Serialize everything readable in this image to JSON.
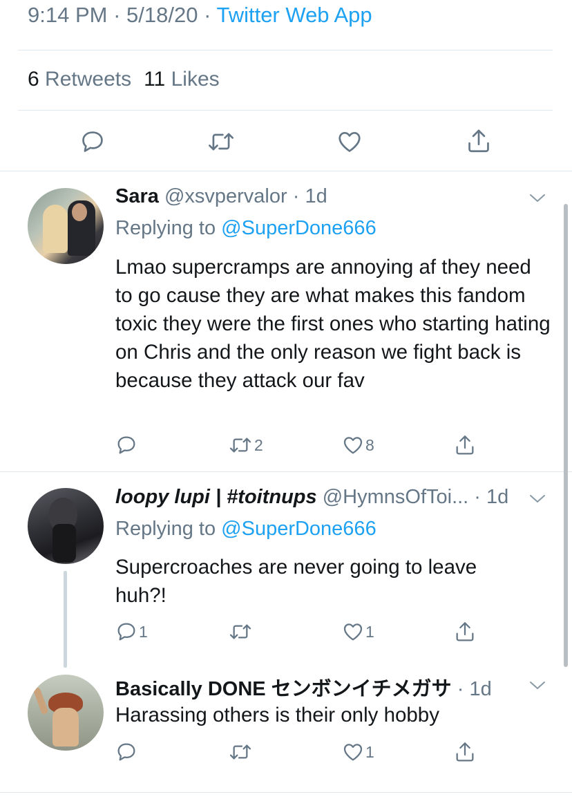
{
  "tweet": {
    "time": "9:14 PM",
    "date": "5/18/20",
    "source": "Twitter Web App",
    "retweets_count": "6",
    "retweets_label": "Retweets",
    "likes_count": "11",
    "likes_label": "Likes"
  },
  "replies": [
    {
      "name": "Sara",
      "handle": "@xsvpervalor",
      "age": "1d",
      "replying_prefix": "Replying to",
      "replying_to": "@SuperDone666",
      "text": "Lmao supercramps are annoying af they need to go cause they are what makes this fandom toxic they were the first ones who starting hating on Chris and the only reason we fight back is because they attack our fav",
      "reply_count": "",
      "retweet_count": "2",
      "like_count": "8"
    },
    {
      "name": "loopy lupi | #toitnups",
      "handle": "@HymnsOfToi...",
      "age": "1d",
      "replying_prefix": "Replying to",
      "replying_to": "@SuperDone666",
      "text": "Supercroaches are never going to leave huh?!",
      "reply_count": "1",
      "retweet_count": "",
      "like_count": "1"
    },
    {
      "name": "Basically DONE センボンイチメガサ",
      "handle": "",
      "age": "1d",
      "text": "Harassing others is their only hobby",
      "reply_count": "",
      "retweet_count": "",
      "like_count": "1"
    }
  ],
  "icons": [
    "reply-icon",
    "retweet-icon",
    "like-icon",
    "share-icon",
    "chevron-down-icon"
  ],
  "colors": {
    "accent": "#1da1f2",
    "secondary_text": "#657786",
    "divider": "#e1e8ed",
    "primary_text": "#14171a"
  }
}
